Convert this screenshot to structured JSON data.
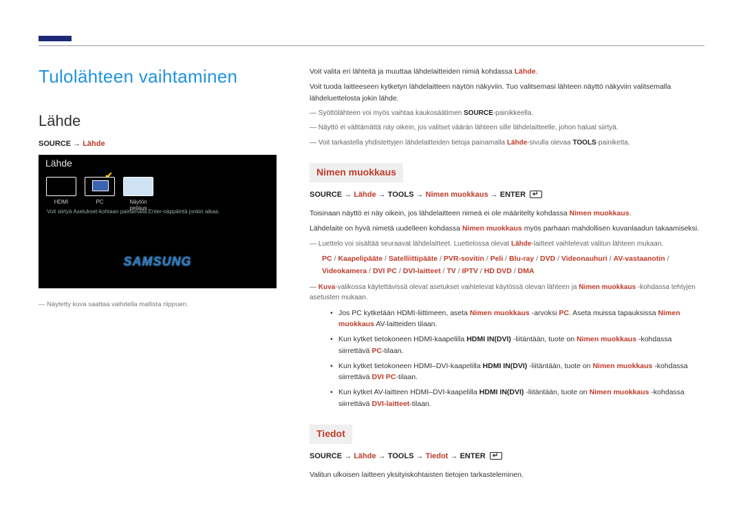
{
  "left": {
    "title": "Tulolähteen vaihtaminen",
    "subtitle": "Lähde",
    "path_source": "SOURCE",
    "path_arrow": " → ",
    "path_lahde": "Lähde",
    "ss_title": "Lähde",
    "ss_items": [
      "HDMI",
      "PC",
      "Näytön peilaus"
    ],
    "ss_hint": "Voit siirtyä Asetukset-kohtaan painamalla Enter-näppäintä jonkin aikaa.",
    "ss_logo": "SAMSUNG",
    "footnote": "Näytetty kuva saattaa vaihdella mallista riippuen."
  },
  "right": {
    "p1_a": "Voit valita eri lähteitä ja muuttaa lähdelaitteiden nimiä kohdassa ",
    "p1_b": "Lähde",
    "p1_c": ".",
    "p2": "Voit tuoda laitteeseen kytketyn lähdelaitteen näytön näkyviin. Tuo valitsemasi lähteen näyttö näkyviin valitsemalla lähdeluettelosta jokin lähde.",
    "n1_a": "Syöttölähteen voi myös vaihtaa kaukosäätimen ",
    "n1_b": "SOURCE",
    "n1_c": "-painikkeella.",
    "n2": "Näyttö ei välttämättä näy oikein, jos valitset väärän lähteen sille lähdelaitteelle, johon haluat siirtyä.",
    "n3_a": "Voit tarkastella yhdistettyjen lähdelaitteiden tietoja painamalla ",
    "n3_b": "Lähde",
    "n3_c": "-sivulla olevaa ",
    "n3_d": "TOOLS",
    "n3_e": "-painiketta.",
    "h_nimen": "Nimen muokkaus",
    "path2": {
      "a": "SOURCE",
      "b": "Lähde",
      "c": "TOOLS",
      "d": "Nimen muokkaus",
      "e": "ENTER"
    },
    "p3_a": "Toisinaan näyttö ei näy oikein, jos lähdelaitteen nimeä ei ole määritelty kohdassa ",
    "p3_b": "Nimen muokkaus",
    "p3_c": ".",
    "p4_a": "Lähdelaite on hyvä nimetä uudelleen kohdassa ",
    "p4_b": "Nimen muokkaus",
    "p4_c": " myös parhaan mahdollisen kuvanlaadun takaamiseksi.",
    "n4_a": "Luettelo voi sisältää seuraavat lähdelaitteet. Luettelossa olevat ",
    "n4_b": "Lähde",
    "n4_c": "-laitteet vaihtelevat valitun lähteen mukaan.",
    "devices": [
      "PC",
      "Kaapelipääte",
      "Satelliittipääte",
      "PVR-sovitin",
      "Peli",
      "Blu-ray",
      "DVD",
      "Videonauhuri",
      "AV-vastaanotin",
      "Videokamera",
      "DVI PC",
      "DVI-laitteet",
      "TV",
      "IPTV",
      "HD DVD",
      "DMA"
    ],
    "n5_a": "Kuva",
    "n5_b": "-valikossa käytettävissä olevat asetukset vaihtelevat käytössä olevan lähteen ja ",
    "n5_c": "Nimen muokkaus",
    "n5_d": " -kohdassa tehtyjen asetusten mukaan.",
    "b1_a": "Jos PC kytketään HDMI-liittimeen, aseta ",
    "b1_b": "Nimen muokkaus",
    "b1_c": " -arvoksi ",
    "b1_d": "PC",
    "b1_e": ". Aseta muissa tapauksissa ",
    "b1_f": "Nimen muokkaus",
    "b1_g": " AV-laitteiden tilaan.",
    "b2_a": "Kun kytket tietokoneen HDMI-kaapelilla ",
    "b2_b": "HDMI IN(DVI)",
    "b2_c": " -liitäntään, tuote on ",
    "b2_d": "Nimen muokkaus",
    "b2_e": " -kohdassa siirrettävä ",
    "b2_f": "PC",
    "b2_g": "-tilaan.",
    "b3_a": "Kun kytket tietokoneen HDMI–DVI-kaapelilla ",
    "b3_b": "HDMI IN(DVI)",
    "b3_c": " -liitäntään, tuote on ",
    "b3_d": "Nimen muokkaus",
    "b3_e": " -kohdassa siirrettävä ",
    "b3_f": "DVI PC",
    "b3_g": "-tilaan.",
    "b4_a": "Kun kytket AV-laitteen HDMI–DVI-kaapelilla ",
    "b4_b": "HDMI IN(DVI)",
    "b4_c": " -liitäntään, tuote on ",
    "b4_d": "Nimen muokkaus",
    "b4_e": " -kohdassa siirrettävä ",
    "b4_f": "DVI-laitteet",
    "b4_g": "-tilaan.",
    "h_tiedot": "Tiedot",
    "path3": {
      "a": "SOURCE",
      "b": "Lähde",
      "c": "TOOLS",
      "d": "Tiedot",
      "e": "ENTER"
    },
    "p_tiedot": "Valitun ulkoisen laitteen yksityiskohtaisten tietojen tarkasteleminen."
  }
}
